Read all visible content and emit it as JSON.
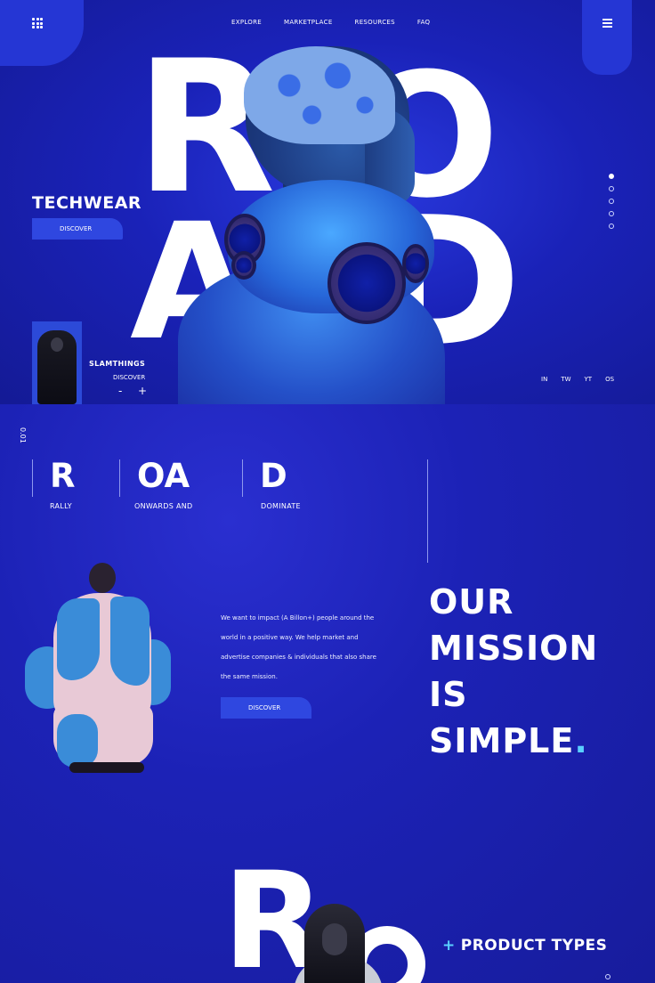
{
  "header": {
    "nav": [
      "EXPLORE",
      "MARKETPLACE",
      "RESOURCES",
      "FAQ"
    ]
  },
  "hero": {
    "big_letters": [
      "R",
      "O",
      "A",
      "D"
    ],
    "tagline": "TECHWEAR",
    "discover_label": "DISCOVER",
    "product_card": {
      "title": "SLAMTHINGS",
      "discover_label": "DISCOVER",
      "minus": "-",
      "plus": "+"
    },
    "slides_total": 5,
    "slide_active": 1,
    "socials": [
      "IN",
      "TW",
      "YT",
      "OS"
    ]
  },
  "road_section": {
    "number": "0.01",
    "columns": [
      {
        "letter": "R",
        "word": "RALLY"
      },
      {
        "letter": "OA",
        "word": "ONWARDS AND"
      },
      {
        "letter": "D",
        "word": "DOMINATE"
      }
    ]
  },
  "mission": {
    "paragraph": "We want to impact (A Billon+) people around the world in a positive way. We help market and advertise companies & individuals that also share the same mission.",
    "discover_label": "DISCOVER",
    "title_lines": [
      "OUR",
      "MISSION",
      "IS",
      "SIMPLE"
    ],
    "title_dot": "."
  },
  "bottom": {
    "big_letter": "R",
    "product_types_plus": "+",
    "product_types_label": "PRODUCT TYPES"
  },
  "colors": {
    "background": "#1a1fb0",
    "accent_blue": "#2f47e0",
    "accent_cyan": "#5ad0ff",
    "text": "#ffffff"
  }
}
